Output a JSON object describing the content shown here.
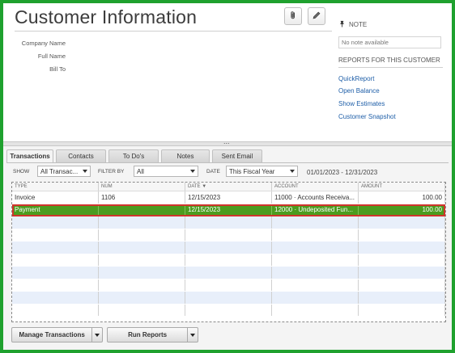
{
  "page": {
    "title": "Customer Information"
  },
  "header_icons": [
    "paperclip-icon",
    "pencil-icon"
  ],
  "customer_fields": [
    {
      "label": "Company Name",
      "value": ""
    },
    {
      "label": "Full Name",
      "value": ""
    },
    {
      "label": "Bill To",
      "value": ""
    }
  ],
  "note": {
    "heading": "NOTE",
    "placeholder": "No note available"
  },
  "reports": {
    "heading": "REPORTS FOR THIS CUSTOMER",
    "links": [
      "QuickReport",
      "Open Balance",
      "Show Estimates",
      "Customer Snapshot"
    ]
  },
  "splitter": {
    "dots": "..."
  },
  "tabs": [
    {
      "label": "Transactions",
      "active": true
    },
    {
      "label": "Contacts",
      "active": false
    },
    {
      "label": "To Do's",
      "active": false
    },
    {
      "label": "Notes",
      "active": false
    },
    {
      "label": "Sent Email",
      "active": false
    }
  ],
  "filters": {
    "show_label": "SHOW",
    "show_value": "All Transac...",
    "filter_by_label": "FILTER BY",
    "filter_by_value": "All",
    "date_label": "DATE",
    "date_value": "This Fiscal Year",
    "date_range": "01/01/2023 - 12/31/2023"
  },
  "table": {
    "columns": [
      "TYPE",
      "NUM",
      "DATE ▼",
      "ACCOUNT",
      "AMOUNT"
    ],
    "rows": [
      {
        "type": "Invoice",
        "num": "1106",
        "date": "12/15/2023",
        "account": "11000 · Accounts Receiva...",
        "amount": "100.00",
        "selected": false
      },
      {
        "type": "Payment",
        "num": "",
        "date": "12/15/2023",
        "account": "12000 · Undeposited Fun...",
        "amount": "100.00",
        "selected": true
      }
    ]
  },
  "buttons": {
    "manage": "Manage Transactions",
    "run_reports": "Run Reports"
  },
  "colors": {
    "frame_border": "#1fa12e",
    "selected_row": "#4b9c1f",
    "selected_outline": "#d0342c",
    "link": "#1f5fa8",
    "alt_row": "#e8effa"
  }
}
